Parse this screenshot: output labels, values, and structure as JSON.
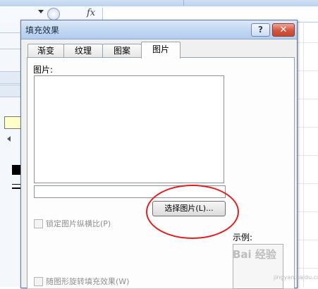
{
  "background": {
    "formula_icon": "fx"
  },
  "dialog": {
    "title": "填充效果",
    "help_label": "?",
    "close_label": "✕",
    "tabs": [
      {
        "label": "渐变",
        "active": false
      },
      {
        "label": "纹理",
        "active": false
      },
      {
        "label": "图案",
        "active": false
      },
      {
        "label": "图片",
        "active": true
      }
    ],
    "picture_section_label": "图片:",
    "filename_value": "",
    "select_picture_button": "选择图片(L)...",
    "lock_aspect_label": "锁定图片纵横比(P)",
    "rotate_with_shape_label": "随图形旋转填充效果(W)",
    "sample_label": "示例:"
  },
  "watermark": {
    "text": "Bai 经验",
    "sub": "jingyan.baidu.com"
  },
  "colors": {
    "annotation_red": "#e02020",
    "titlebar": "#c3d8f2",
    "close_button": "#d3533d"
  }
}
